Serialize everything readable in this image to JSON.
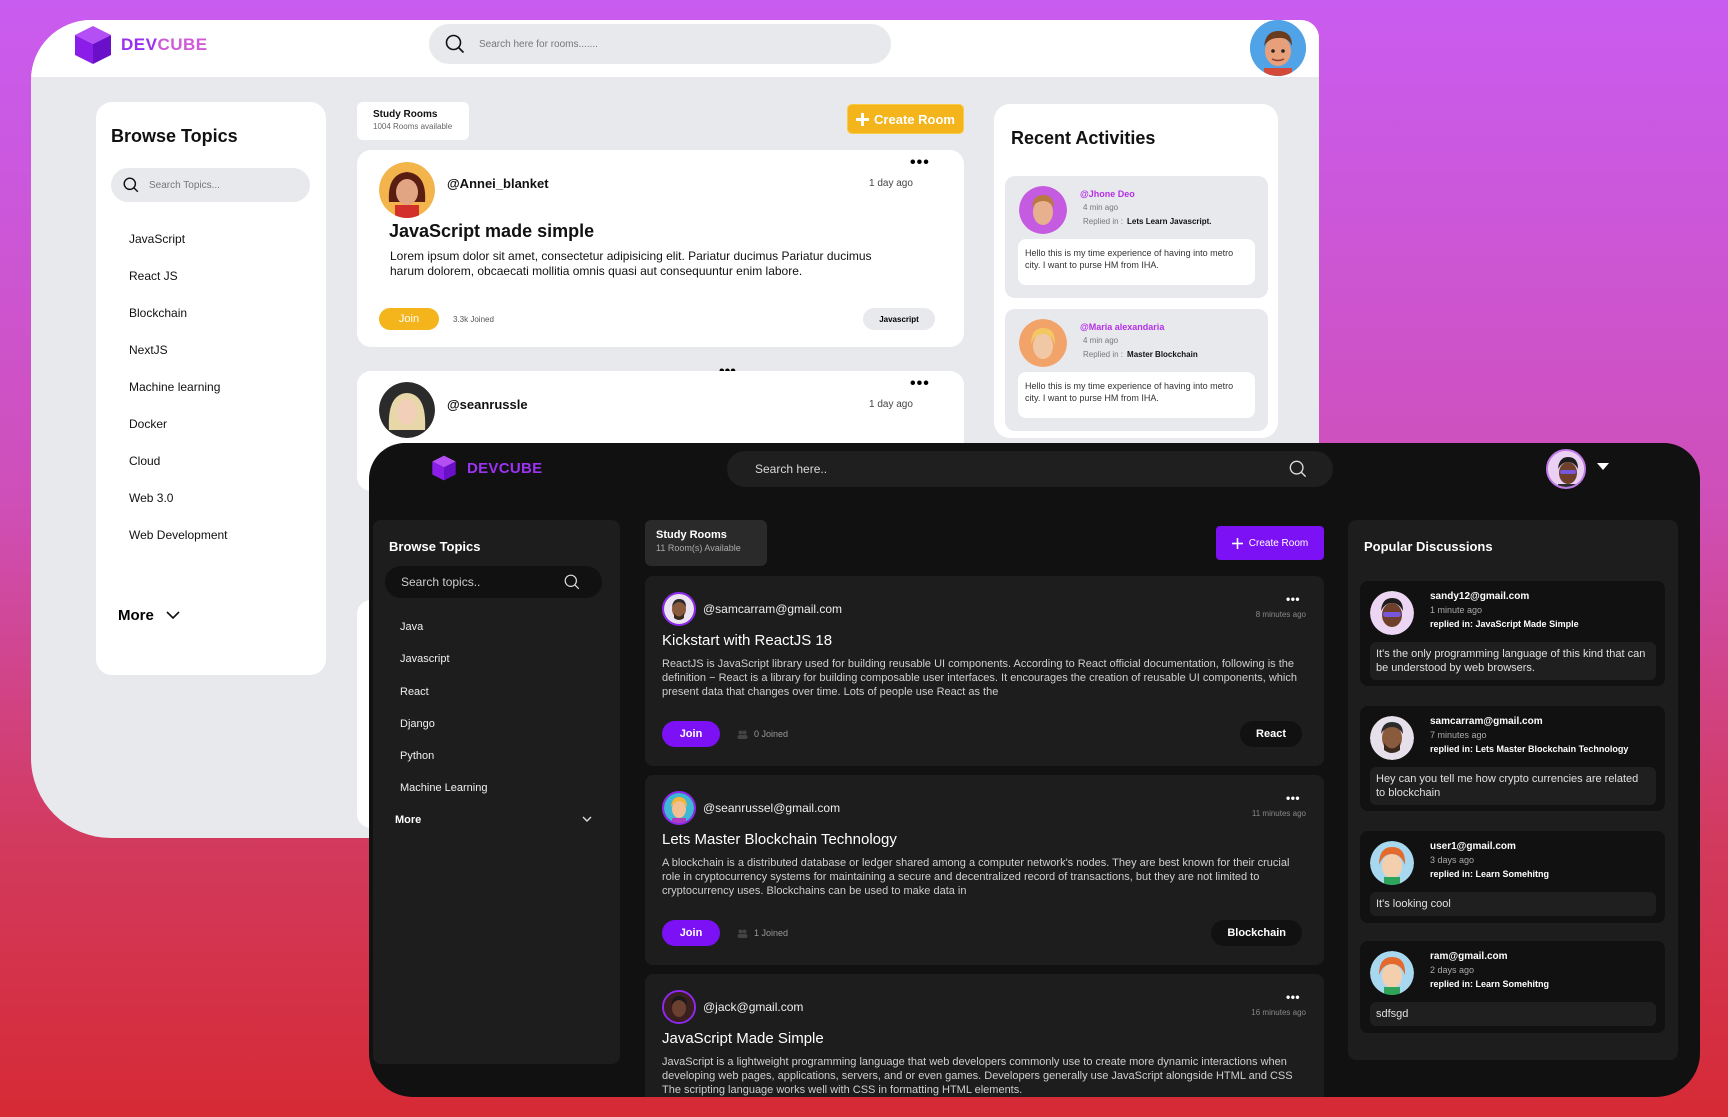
{
  "brand": {
    "dev": "DEV",
    "cube": "CUBE",
    "full": "DEVCUBE"
  },
  "light": {
    "search_placeholder": "Search here for rooms.......",
    "browse": {
      "title": "Browse Topics",
      "search_placeholder": "Search Topics...",
      "topics": [
        "JavaScript",
        "React JS",
        "Blockchain",
        "NextJS",
        "Machine learning",
        "Docker",
        "Cloud",
        "Web 3.0",
        "Web Development"
      ],
      "more": "More"
    },
    "study_rooms": {
      "title": "Study Rooms",
      "count": "1004 Rooms available"
    },
    "create_room": "Create Room",
    "rooms": [
      {
        "user": "@Annei_blanket",
        "time": "1 day ago",
        "title": "JavaScript made simple",
        "body": "Lorem ipsum dolor sit amet, consectetur adipisicing elit. Pariatur ducimus Pariatur ducimus harum dolorem, obcaecati mollitia omnis quasi aut consequuntur enim labore.",
        "join": "Join",
        "joined": "3.3k Joined",
        "tag": "Javascript"
      },
      {
        "user": "@seanrussle",
        "time": "1 day ago"
      }
    ],
    "activities": {
      "title": "Recent Activities",
      "items": [
        {
          "who": "@Jhone Deo",
          "when": "4 min ago",
          "replied_label": "Replied in :",
          "replied_in": "Lets Learn Javascript.",
          "message": "Hello this is my time experience of having into metro city. I want to purse HM from IHA."
        },
        {
          "who": "@Maria alexandaria",
          "when": "4 min ago",
          "replied_label": "Replied in :",
          "replied_in": "Master Blockchain",
          "message": "Hello this is my time experience of having into metro city. I want to purse HM from IHA."
        }
      ]
    }
  },
  "dark": {
    "search_placeholder": "Search here..",
    "browse": {
      "title": "Browse Topics",
      "search_placeholder": "Search topics..",
      "topics": [
        "Java",
        "Javascript",
        "React",
        "Django",
        "Python",
        "Machine Learning"
      ],
      "more": "More"
    },
    "study_rooms": {
      "title": "Study Rooms",
      "count": "11 Room(s) Available"
    },
    "create_room": "Create Room",
    "rooms": [
      {
        "user": "@samcarram@gmail.com",
        "time": "8 minutes ago",
        "title": "Kickstart with ReactJS 18",
        "body": "ReactJS is JavaScript library used for building reusable UI components. According to React official documentation, following is the definition − React is a library for building composable user interfaces. It encourages the creation of reusable UI components, which present data that changes over time. Lots of people use React as the",
        "join": "Join",
        "joined": "0 Joined",
        "tag": "React"
      },
      {
        "user": "@seanrussel@gmail.com",
        "time": "11 minutes ago",
        "title": "Lets Master Blockchain Technology",
        "body": "A blockchain is a distributed database or ledger shared among a computer network's nodes. They are best known for their crucial role in cryptocurrency systems for maintaining a secure and decentralized record of transactions, but they are not limited to cryptocurrency uses. Blockchains can be used to make data in",
        "join": "Join",
        "joined": "1 Joined",
        "tag": "Blockchain"
      },
      {
        "user": "@jack@gmail.com",
        "time": "16 minutes ago",
        "title": "JavaScript Made Simple",
        "body": "JavaScript is a lightweight programming language that web developers commonly use to create more dynamic interactions when developing web pages, applications, servers, and or even games. Developers generally use JavaScript alongside HTML and CSS The scripting language works well with CSS in formatting HTML elements."
      }
    ],
    "popular": {
      "title": "Popular Discussions",
      "items": [
        {
          "who": "sandy12@gmail.com",
          "when": "1 minute ago",
          "replied_label": "replied in:",
          "replied_in": "JavaScript Made Simple",
          "message": "It's the only programming language of this kind that can be understood by web browsers."
        },
        {
          "who": "samcarram@gmail.com",
          "when": "7 minutes ago",
          "replied_label": "replied in:",
          "replied_in": "Lets Master Blockchain Technology",
          "message": "Hey can you tell me how crypto currencies are related to blockchain"
        },
        {
          "who": "user1@gmail.com",
          "when": "3 days ago",
          "replied_label": "replied in:",
          "replied_in": "Learn Somehitng",
          "message": "It's looking cool"
        },
        {
          "who": "ram@gmail.com",
          "when": "2 days ago",
          "replied_label": "replied in:",
          "replied_in": "Learn Somehitng",
          "message": "sdfsgd"
        }
      ]
    }
  },
  "colors": {
    "accent_light": "#f3b51b",
    "accent_dark": "#7c11f5",
    "brand": "#9b2ff0"
  }
}
